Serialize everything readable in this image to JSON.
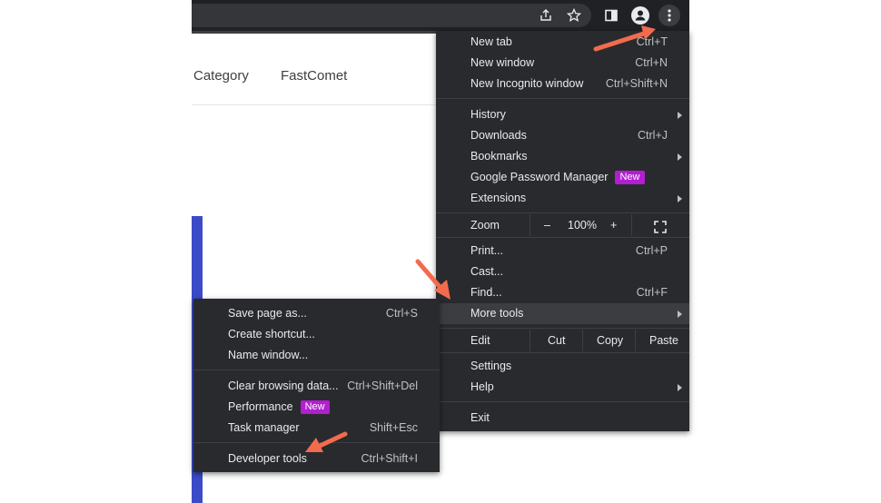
{
  "nav": {
    "category": "Category",
    "fastcomet": "FastComet"
  },
  "colors": {
    "toolbar": "#202124",
    "menu_bg": "#292a2d",
    "highlight": "#3c3d41",
    "badge": "#b11fcf",
    "accent_bar": "#3b4bc8",
    "arrow": "#f26b4f"
  },
  "toolbar": {
    "icons": [
      "share-icon",
      "star-icon",
      "side-panel-icon",
      "profile-icon",
      "kebab-menu-icon"
    ]
  },
  "main_menu": {
    "new_tab": {
      "label": "New tab",
      "shortcut": "Ctrl+T"
    },
    "new_window": {
      "label": "New window",
      "shortcut": "Ctrl+N"
    },
    "new_incognito": {
      "label": "New Incognito window",
      "shortcut": "Ctrl+Shift+N"
    },
    "history": {
      "label": "History"
    },
    "downloads": {
      "label": "Downloads",
      "shortcut": "Ctrl+J"
    },
    "bookmarks": {
      "label": "Bookmarks"
    },
    "password_manager": {
      "label": "Google Password Manager",
      "badge": "New"
    },
    "extensions": {
      "label": "Extensions"
    },
    "zoom": {
      "label": "Zoom",
      "minus": "–",
      "value": "100%",
      "plus": "+"
    },
    "print": {
      "label": "Print...",
      "shortcut": "Ctrl+P"
    },
    "cast": {
      "label": "Cast..."
    },
    "find": {
      "label": "Find...",
      "shortcut": "Ctrl+F"
    },
    "more_tools": {
      "label": "More tools"
    },
    "edit": {
      "label": "Edit",
      "cut": "Cut",
      "copy": "Copy",
      "paste": "Paste"
    },
    "settings": {
      "label": "Settings"
    },
    "help": {
      "label": "Help"
    },
    "exit": {
      "label": "Exit"
    }
  },
  "sub_menu": {
    "save_page": {
      "label": "Save page as...",
      "shortcut": "Ctrl+S"
    },
    "create_shortcut": {
      "label": "Create shortcut..."
    },
    "name_window": {
      "label": "Name window..."
    },
    "clear_data": {
      "label": "Clear browsing data...",
      "shortcut": "Ctrl+Shift+Del"
    },
    "performance": {
      "label": "Performance",
      "badge": "New"
    },
    "task_manager": {
      "label": "Task manager",
      "shortcut": "Shift+Esc"
    },
    "developer_tools": {
      "label": "Developer tools",
      "shortcut": "Ctrl+Shift+I"
    }
  }
}
